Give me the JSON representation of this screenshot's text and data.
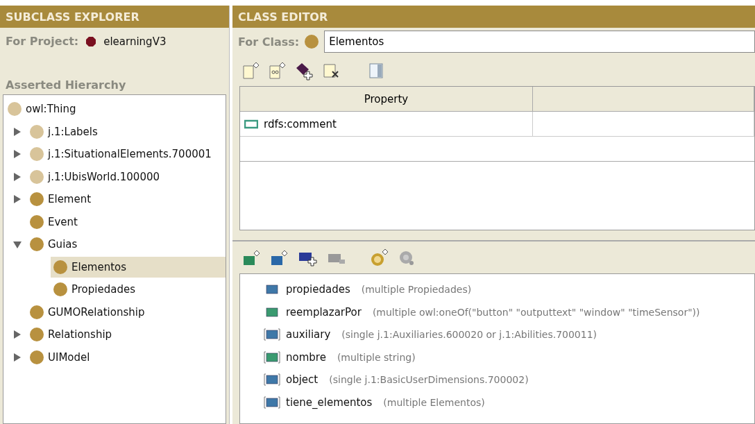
{
  "subclass_explorer": {
    "title": "SUBCLASS EXPLORER",
    "project_label": "For Project:",
    "project": "elearningV3",
    "hierarchy_label": "Asserted Hierarchy",
    "tree": [
      {
        "label": "owl:Thing",
        "color": "#d8c49a",
        "kind": "root",
        "selected": false,
        "children": [
          {
            "label": "j.1:Labels",
            "color": "#d8c49a",
            "kind": "branch",
            "expanded": false,
            "selected": false
          },
          {
            "label": "j.1:SituationalElements.700001",
            "color": "#d8c49a",
            "kind": "branch",
            "expanded": false,
            "selected": false
          },
          {
            "label": "j.1:UbisWorld.100000",
            "color": "#d8c49a",
            "kind": "branch",
            "expanded": false,
            "selected": false
          },
          {
            "label": "Element",
            "color": "#b8913f",
            "kind": "branch",
            "expanded": false,
            "selected": false
          },
          {
            "label": "Event",
            "color": "#b8913f",
            "kind": "leaf",
            "selected": false
          },
          {
            "label": "Guias",
            "color": "#b8913f",
            "kind": "branch",
            "expanded": true,
            "selected": false,
            "children": [
              {
                "label": "Elementos",
                "color": "#b8913f",
                "kind": "leaf",
                "selected": true
              },
              {
                "label": "Propiedades",
                "color": "#b8913f",
                "kind": "leaf",
                "selected": false
              }
            ]
          },
          {
            "label": "GUMORelationship",
            "color": "#b8913f",
            "kind": "leaf",
            "selected": false
          },
          {
            "label": "Relationship",
            "color": "#b8913f",
            "kind": "branch",
            "expanded": false,
            "selected": false
          },
          {
            "label": "UIModel",
            "color": "#b8913f",
            "kind": "branch",
            "expanded": false,
            "selected": false
          }
        ]
      }
    ]
  },
  "class_editor": {
    "title": "CLASS EDITOR",
    "class_label": "For Class:",
    "class_name": "Elementos",
    "table": {
      "columns": [
        "Property"
      ],
      "rows": [
        {
          "property": "rdfs:comment"
        }
      ]
    },
    "properties": [
      {
        "name": "propiedades",
        "detail": "(multiple Propiedades)",
        "color": "#3f78a8",
        "inherited": false
      },
      {
        "name": "reemplazarPor",
        "detail": "(multiple owl:oneOf(\"button\" \"outputtext\" \"window\" \"timeSensor\"))",
        "color": "#3a9a70",
        "inherited": false
      },
      {
        "name": "auxiliary",
        "detail": "(single j.1:Auxiliaries.600020 or j.1:Abilities.700011)",
        "color": "#3f78a8",
        "inherited": true
      },
      {
        "name": "nombre",
        "detail": "(multiple string)",
        "color": "#3a9a70",
        "inherited": true
      },
      {
        "name": "object",
        "detail": "(single j.1:BasicUserDimensions.700002)",
        "color": "#3f78a8",
        "inherited": true
      },
      {
        "name": "tiene_elementos",
        "detail": "(multiple Elementos)",
        "color": "#3f78a8",
        "inherited": true
      }
    ]
  }
}
